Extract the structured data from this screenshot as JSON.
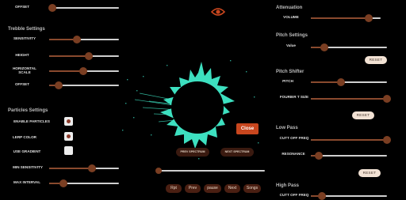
{
  "top": {
    "offset_label": "OFFSET",
    "eye_icon": "eye-icon"
  },
  "treble": {
    "title": "Trebble Settings",
    "sensitivity": "SENSITIVITY",
    "height": "HEIGHT",
    "horizontal_scale": "HORIZONTAL SCALE",
    "offset": "OFFSET"
  },
  "particles": {
    "title": "Particles Settings",
    "enable": "ENABLE PARTICLES",
    "lerp": "LERP COLOR",
    "gradient": "USE GRADIENT",
    "min_sens": "MIN SENSITIVITY",
    "max_interval": "MAX INTERVAL"
  },
  "attenuation": {
    "title": "Attenuation",
    "volume": "VOLUME"
  },
  "pitch_settings": {
    "title": "Pitch Settings",
    "value": "Value",
    "reset": "RESET"
  },
  "pitch_shifter": {
    "title": "Pitch Shifter",
    "pitch": "PITCH",
    "fourier": "FOURIER T SIZE",
    "reset": "RESET"
  },
  "low_pass": {
    "title": "Low Pass",
    "cutoff": "CUTT OFF FREQ",
    "resonance": "RESONANCE",
    "reset": "RESET"
  },
  "high_pass": {
    "title": "High Pass",
    "cutoff": "CUTT OFF FREQ"
  },
  "center": {
    "close": "Close",
    "prev_spectrum": "PREV SPECTRUM",
    "next_spectrum": "NEXT SPECTRUM"
  },
  "controls": {
    "rpt": "Rpt",
    "prev": "Prev",
    "pause": "pause",
    "next": "Next",
    "songs": "Songs"
  },
  "colors": {
    "accent": "#7a3e22",
    "spectrum": "#3de0c0",
    "close": "#c8461e"
  }
}
